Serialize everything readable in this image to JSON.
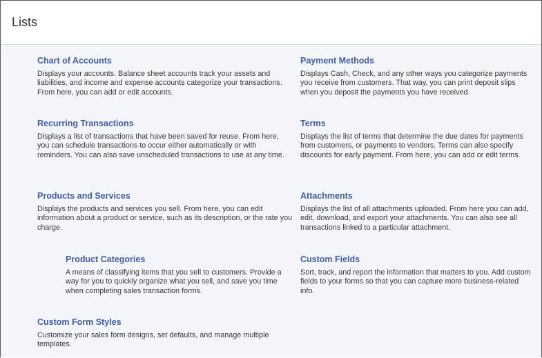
{
  "page": {
    "title": "Lists"
  },
  "items": [
    {
      "label": "Chart of Accounts",
      "description": "Displays your accounts. Balance sheet accounts track your assets and liabilities, and income and expense accounts categorize your transactions. From here, you can add or edit accounts."
    },
    {
      "label": "Payment Methods",
      "description": "Displays Cash, Check, and any other ways you categorize payments you receive from customers. That way, you can print deposit slips when you deposit the payments you have received."
    },
    {
      "label": "Recurring Transactions",
      "description": "Displays a list of transactions that have been saved for reuse. From here, you can schedule transactions to occur either automatically or with reminders. You can also save unscheduled transactions to use at any time."
    },
    {
      "label": "Terms",
      "description": "Displays the list of terms that determine the due dates for payments from customers, or payments to vendors. Terms can also specify discounts for early payment. From here, you can add or edit terms."
    },
    {
      "label": "Products and Services",
      "description": "Displays the products and services you sell. From here, you can edit information about a product or service, such as its description, or the rate you charge."
    },
    {
      "label": "Attachments",
      "description": "Displays the list of all attachments uploaded. From here you can add, edit, download, and export your attachments. You can also see all transactions linked to a particular attachment."
    },
    {
      "label": "Product Categories",
      "description": "A means of classifying items that you sell to customers. Provide a way for you to quickly organize what you sell, and save you time when completing sales transaction forms."
    },
    {
      "label": "Custom Fields",
      "description": "Sort, track, and report the information that matters to you. Add custom fields to your forms so that you can capture more business-related info."
    },
    {
      "label": "Custom Form Styles",
      "description": "Customize your sales form designs, set defaults, and manage multiple templates."
    }
  ]
}
